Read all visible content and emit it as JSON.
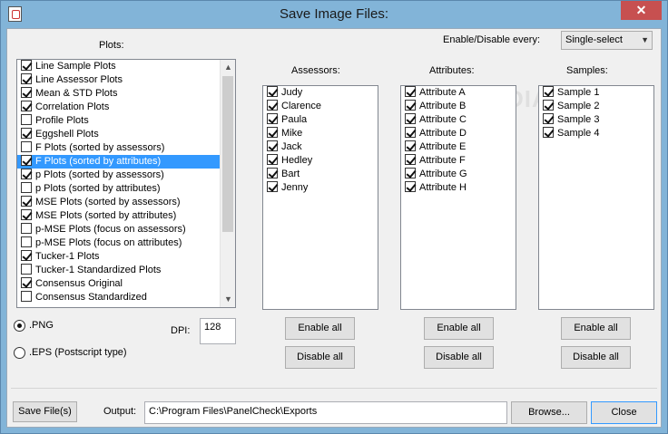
{
  "window": {
    "title": "Save Image Files:",
    "close_label": "✕"
  },
  "plots": {
    "label": "Plots:",
    "items": [
      {
        "label": "Line Sample Plots",
        "checked": true
      },
      {
        "label": "Line Assessor Plots",
        "checked": true
      },
      {
        "label": "Mean & STD Plots",
        "checked": true
      },
      {
        "label": "Correlation Plots",
        "checked": true
      },
      {
        "label": "Profile Plots",
        "checked": false
      },
      {
        "label": "Eggshell Plots",
        "checked": true
      },
      {
        "label": "F Plots (sorted by assessors)",
        "checked": false
      },
      {
        "label": "F Plots (sorted by attributes)",
        "checked": true,
        "selected": true
      },
      {
        "label": "p Plots (sorted by assessors)",
        "checked": true
      },
      {
        "label": "p Plots (sorted by attributes)",
        "checked": false
      },
      {
        "label": "MSE Plots (sorted by assessors)",
        "checked": true
      },
      {
        "label": "MSE Plots (sorted by attributes)",
        "checked": true
      },
      {
        "label": "p-MSE Plots (focus on assessors)",
        "checked": false
      },
      {
        "label": "p-MSE Plots (focus on attributes)",
        "checked": false
      },
      {
        "label": "Tucker-1 Plots",
        "checked": true
      },
      {
        "label": "Tucker-1 Standardized Plots",
        "checked": false
      },
      {
        "label": "Consensus Original",
        "checked": true
      },
      {
        "label": "Consensus Standardized",
        "checked": false
      }
    ]
  },
  "enable_every": {
    "label": "Enable/Disable every:",
    "value": "Single-select"
  },
  "assessors": {
    "label": "Assessors:",
    "items": [
      {
        "label": "Judy",
        "checked": true
      },
      {
        "label": "Clarence",
        "checked": true
      },
      {
        "label": "Paula",
        "checked": true
      },
      {
        "label": "Mike",
        "checked": true
      },
      {
        "label": "Jack",
        "checked": true
      },
      {
        "label": "Hedley",
        "checked": true
      },
      {
        "label": "Bart",
        "checked": true
      },
      {
        "label": "Jenny",
        "checked": true
      }
    ],
    "enable_label": "Enable all",
    "disable_label": "Disable all"
  },
  "attributes": {
    "label": "Attributes:",
    "items": [
      {
        "label": "Attribute A",
        "checked": true
      },
      {
        "label": "Attribute B",
        "checked": true
      },
      {
        "label": "Attribute C",
        "checked": true
      },
      {
        "label": "Attribute D",
        "checked": true
      },
      {
        "label": "Attribute E",
        "checked": true
      },
      {
        "label": "Attribute F",
        "checked": true
      },
      {
        "label": "Attribute G",
        "checked": true
      },
      {
        "label": "Attribute H",
        "checked": true
      }
    ],
    "enable_label": "Enable all",
    "disable_label": "Disable all"
  },
  "samples": {
    "label": "Samples:",
    "items": [
      {
        "label": "Sample 1",
        "checked": true
      },
      {
        "label": "Sample 2",
        "checked": true
      },
      {
        "label": "Sample 3",
        "checked": true
      },
      {
        "label": "Sample 4",
        "checked": true
      }
    ],
    "enable_label": "Enable all",
    "disable_label": "Disable all"
  },
  "format": {
    "png_label": ".PNG",
    "png_selected": true,
    "eps_label": ".EPS (Postscript type)",
    "eps_selected": false,
    "dpi_label": "DPI:",
    "dpi_value": "128"
  },
  "footer": {
    "save_label": "Save File(s)",
    "output_label": "Output:",
    "output_value": "C:\\Program Files\\PanelCheck\\Exports",
    "browse_label": "Browse...",
    "close_label": "Close"
  },
  "watermark": "SOFTPEDIA"
}
